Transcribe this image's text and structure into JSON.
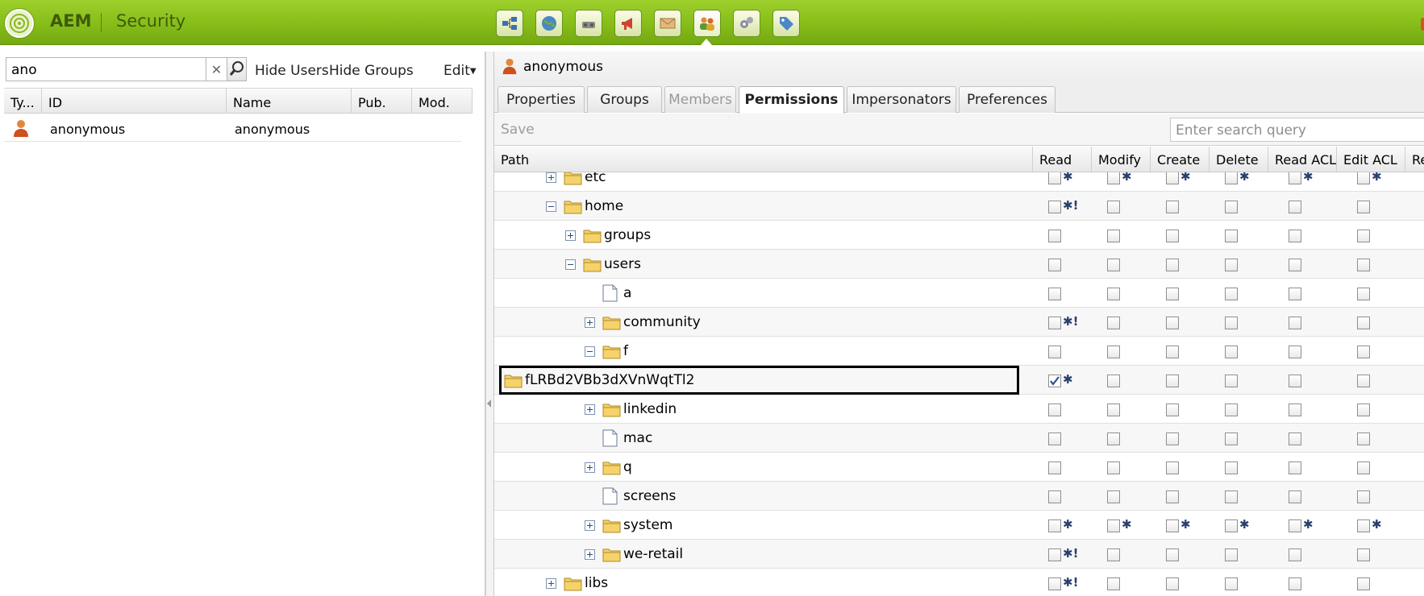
{
  "header": {
    "brand": "AEM",
    "section": "Security",
    "nav_icons": [
      "sites-icon",
      "globe-icon",
      "tools-icon",
      "campaign-icon",
      "inbox-icon",
      "users-icon",
      "workflow-icon",
      "tagging-icon"
    ],
    "active_nav": "users-icon"
  },
  "left": {
    "search_value": "ano",
    "clear_glyph": "✕",
    "hide_users": "Hide Users",
    "hide_groups": "Hide Groups",
    "edit": "Edit",
    "columns": [
      "Ty...",
      "ID",
      "Name",
      "Pub.",
      "Mod."
    ],
    "users": [
      {
        "type_icon": "user-icon",
        "id": "anonymous",
        "name": "anonymous",
        "pub": "",
        "mod": ""
      }
    ]
  },
  "right": {
    "user_title": "anonymous",
    "tabs": [
      {
        "label": "Properties",
        "state": "normal"
      },
      {
        "label": "Groups",
        "state": "normal"
      },
      {
        "label": "Members",
        "state": "disabled"
      },
      {
        "label": "Permissions",
        "state": "active"
      },
      {
        "label": "Impersonators",
        "state": "normal"
      },
      {
        "label": "Preferences",
        "state": "normal"
      }
    ],
    "save": "Save",
    "search_placeholder": "Enter search query",
    "columns": [
      "Path",
      "Read",
      "Modify",
      "Create",
      "Delete",
      "Read ACL",
      "Edit ACL",
      "Re"
    ],
    "rows": [
      {
        "name": "etc",
        "depth": 1,
        "toggle": "plus",
        "icon": "folder",
        "perms": [
          {
            "c": false,
            "m": "✱"
          },
          {
            "c": false,
            "m": "✱"
          },
          {
            "c": false,
            "m": "✱"
          },
          {
            "c": false,
            "m": "✱"
          },
          {
            "c": false,
            "m": "✱"
          },
          {
            "c": false,
            "m": "✱"
          }
        ]
      },
      {
        "name": "home",
        "depth": 1,
        "toggle": "minus",
        "icon": "folder",
        "perms": [
          {
            "c": false,
            "m": "✱!"
          },
          {
            "c": false,
            "m": ""
          },
          {
            "c": false,
            "m": ""
          },
          {
            "c": false,
            "m": ""
          },
          {
            "c": false,
            "m": ""
          },
          {
            "c": false,
            "m": ""
          }
        ]
      },
      {
        "name": "groups",
        "depth": 2,
        "toggle": "plus",
        "icon": "folder",
        "perms": [
          {
            "c": false,
            "m": ""
          },
          {
            "c": false,
            "m": ""
          },
          {
            "c": false,
            "m": ""
          },
          {
            "c": false,
            "m": ""
          },
          {
            "c": false,
            "m": ""
          },
          {
            "c": false,
            "m": ""
          }
        ]
      },
      {
        "name": "users",
        "depth": 2,
        "toggle": "minus",
        "icon": "folder",
        "perms": [
          {
            "c": false,
            "m": ""
          },
          {
            "c": false,
            "m": ""
          },
          {
            "c": false,
            "m": ""
          },
          {
            "c": false,
            "m": ""
          },
          {
            "c": false,
            "m": ""
          },
          {
            "c": false,
            "m": ""
          }
        ]
      },
      {
        "name": "a",
        "depth": 3,
        "toggle": "none",
        "icon": "doc",
        "perms": [
          {
            "c": false,
            "m": ""
          },
          {
            "c": false,
            "m": ""
          },
          {
            "c": false,
            "m": ""
          },
          {
            "c": false,
            "m": ""
          },
          {
            "c": false,
            "m": ""
          },
          {
            "c": false,
            "m": ""
          }
        ]
      },
      {
        "name": "community",
        "depth": 3,
        "toggle": "plus",
        "icon": "folder",
        "perms": [
          {
            "c": false,
            "m": "✱!"
          },
          {
            "c": false,
            "m": ""
          },
          {
            "c": false,
            "m": ""
          },
          {
            "c": false,
            "m": ""
          },
          {
            "c": false,
            "m": ""
          },
          {
            "c": false,
            "m": ""
          }
        ]
      },
      {
        "name": "f",
        "depth": 3,
        "toggle": "minus",
        "icon": "folder",
        "perms": [
          {
            "c": false,
            "m": ""
          },
          {
            "c": false,
            "m": ""
          },
          {
            "c": false,
            "m": ""
          },
          {
            "c": false,
            "m": ""
          },
          {
            "c": false,
            "m": ""
          },
          {
            "c": false,
            "m": ""
          }
        ]
      },
      {
        "name": "fLRBd2VBb3dXVnWqtTl2",
        "depth": 0,
        "toggle": "none",
        "icon": "folder",
        "highlight": true,
        "perms": [
          {
            "c": true,
            "m": "✱"
          },
          {
            "c": false,
            "m": ""
          },
          {
            "c": false,
            "m": ""
          },
          {
            "c": false,
            "m": ""
          },
          {
            "c": false,
            "m": ""
          },
          {
            "c": false,
            "m": ""
          }
        ]
      },
      {
        "name": "linkedin",
        "depth": 3,
        "toggle": "plus",
        "icon": "folder",
        "perms": [
          {
            "c": false,
            "m": ""
          },
          {
            "c": false,
            "m": ""
          },
          {
            "c": false,
            "m": ""
          },
          {
            "c": false,
            "m": ""
          },
          {
            "c": false,
            "m": ""
          },
          {
            "c": false,
            "m": ""
          }
        ]
      },
      {
        "name": "mac",
        "depth": 3,
        "toggle": "none",
        "icon": "doc",
        "perms": [
          {
            "c": false,
            "m": ""
          },
          {
            "c": false,
            "m": ""
          },
          {
            "c": false,
            "m": ""
          },
          {
            "c": false,
            "m": ""
          },
          {
            "c": false,
            "m": ""
          },
          {
            "c": false,
            "m": ""
          }
        ]
      },
      {
        "name": "q",
        "depth": 3,
        "toggle": "plus",
        "icon": "folder",
        "perms": [
          {
            "c": false,
            "m": ""
          },
          {
            "c": false,
            "m": ""
          },
          {
            "c": false,
            "m": ""
          },
          {
            "c": false,
            "m": ""
          },
          {
            "c": false,
            "m": ""
          },
          {
            "c": false,
            "m": ""
          }
        ]
      },
      {
        "name": "screens",
        "depth": 3,
        "toggle": "none",
        "icon": "doc",
        "perms": [
          {
            "c": false,
            "m": ""
          },
          {
            "c": false,
            "m": ""
          },
          {
            "c": false,
            "m": ""
          },
          {
            "c": false,
            "m": ""
          },
          {
            "c": false,
            "m": ""
          },
          {
            "c": false,
            "m": ""
          }
        ]
      },
      {
        "name": "system",
        "depth": 3,
        "toggle": "plus",
        "icon": "folder",
        "perms": [
          {
            "c": false,
            "m": "✱"
          },
          {
            "c": false,
            "m": "✱"
          },
          {
            "c": false,
            "m": "✱"
          },
          {
            "c": false,
            "m": "✱"
          },
          {
            "c": false,
            "m": "✱"
          },
          {
            "c": false,
            "m": "✱"
          }
        ]
      },
      {
        "name": "we-retail",
        "depth": 3,
        "toggle": "plus",
        "icon": "folder",
        "perms": [
          {
            "c": false,
            "m": "✱!"
          },
          {
            "c": false,
            "m": ""
          },
          {
            "c": false,
            "m": ""
          },
          {
            "c": false,
            "m": ""
          },
          {
            "c": false,
            "m": ""
          },
          {
            "c": false,
            "m": ""
          }
        ]
      },
      {
        "name": "libs",
        "depth": 1,
        "toggle": "plus",
        "icon": "folder",
        "perms": [
          {
            "c": false,
            "m": "✱!"
          },
          {
            "c": false,
            "m": ""
          },
          {
            "c": false,
            "m": ""
          },
          {
            "c": false,
            "m": ""
          },
          {
            "c": false,
            "m": ""
          },
          {
            "c": false,
            "m": ""
          }
        ]
      }
    ]
  },
  "colors": {
    "header_green": "#86bd18",
    "folder_yellow": "#f5d36a",
    "mark_blue": "#2a3f6e"
  }
}
